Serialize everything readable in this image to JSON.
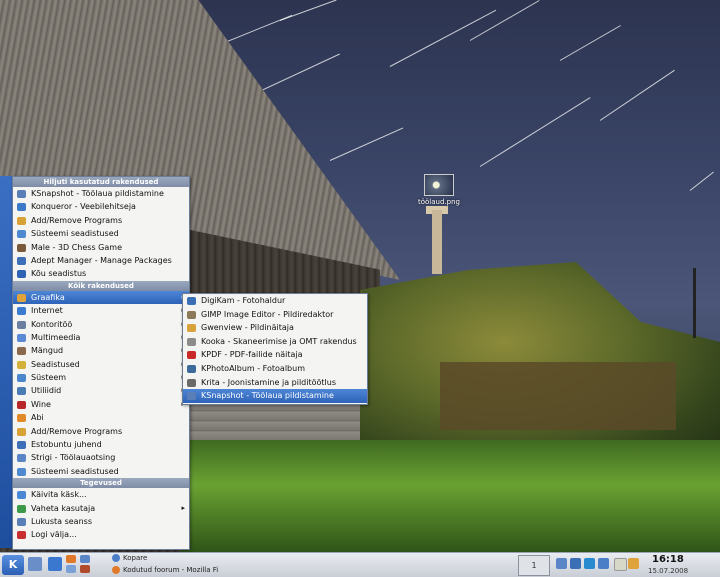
{
  "desktop": {
    "icon_label": "töölaud.png"
  },
  "kmenu": {
    "recent_header": "Hiljuti kasutatud rakendused",
    "recent": [
      {
        "label": "KSnapshot - Töölaua pildistamine",
        "icon": "camera-icon",
        "color": "#5a7fb8"
      },
      {
        "label": "Konqueror - Veebilehitseja",
        "icon": "globe-icon",
        "color": "#3c79c8"
      },
      {
        "label": "Add/Remove Programs",
        "icon": "package-icon",
        "color": "#d8a236"
      },
      {
        "label": "Süsteemi seadistused",
        "icon": "settings-icon",
        "color": "#4f8ad0"
      },
      {
        "label": "Male - 3D Chess Game",
        "icon": "chess-icon",
        "color": "#7b5a3c"
      },
      {
        "label": "Adept Manager - Manage Packages",
        "icon": "adept-icon",
        "color": "#3d6fb6"
      },
      {
        "label": "Kõu seadistus",
        "icon": "kde-icon",
        "color": "#2f63b4"
      }
    ],
    "all_header": "Kõik rakendused",
    "all": [
      {
        "label": "Graafika",
        "icon": "graphics-icon",
        "color": "#e0a23a",
        "submenu": true,
        "highlighted": true
      },
      {
        "label": "Internet",
        "icon": "internet-icon",
        "color": "#3a7bd0",
        "submenu": true
      },
      {
        "label": "Kontoritöö",
        "icon": "office-icon",
        "color": "#6d7fa0",
        "submenu": true
      },
      {
        "label": "Multimeedia",
        "icon": "multimedia-icon",
        "color": "#5a8ad6",
        "submenu": true
      },
      {
        "label": "Mängud",
        "icon": "games-icon",
        "color": "#8a6a4c",
        "submenu": true
      },
      {
        "label": "Seadistused",
        "icon": "settings-icon",
        "color": "#d4b23a",
        "submenu": true
      },
      {
        "label": "Süsteem",
        "icon": "system-icon",
        "color": "#4a86cc",
        "submenu": true
      },
      {
        "label": "Utiliidid",
        "icon": "utilities-icon",
        "color": "#4a7bb4",
        "submenu": true
      },
      {
        "label": "Wine",
        "icon": "wine-icon",
        "color": "#b8262a",
        "submenu": true
      },
      {
        "label": "Abi",
        "icon": "help-icon",
        "color": "#e08a2a"
      },
      {
        "label": "Add/Remove Programs",
        "icon": "package-icon",
        "color": "#d8a236"
      },
      {
        "label": "Estobuntu juhend",
        "icon": "guide-icon",
        "color": "#3c6fb6"
      },
      {
        "label": "Strigi - Töölauaotsing",
        "icon": "search-icon",
        "color": "#5a86c8"
      },
      {
        "label": "Süsteemi seadistused",
        "icon": "settings-icon",
        "color": "#4f8ad0"
      }
    ],
    "actions_header": "Tegevused",
    "actions": [
      {
        "label": "Käivita käsk...",
        "icon": "run-icon",
        "color": "#4a88d6"
      },
      {
        "label": "Vaheta kasutaja",
        "icon": "switch-user-icon",
        "color": "#3c9a48",
        "submenu": true
      },
      {
        "label": "Lukusta seanss",
        "icon": "lock-icon",
        "color": "#5a7fb8"
      },
      {
        "label": "Logi välja...",
        "icon": "logout-icon",
        "color": "#c83030"
      }
    ]
  },
  "submenu": {
    "items": [
      {
        "label": "DigiKam - Fotohaldur",
        "icon": "digikam-icon",
        "color": "#3a6fb6"
      },
      {
        "label": "GIMP Image Editor - Pildiredaktor",
        "icon": "gimp-icon",
        "color": "#8a7a5a"
      },
      {
        "label": "Gwenview - Pildinäitaja",
        "icon": "gwenview-icon",
        "color": "#d8a23a"
      },
      {
        "label": "Kooka - Skaneerimise ja OMT rakendus",
        "icon": "scanner-icon",
        "color": "#8c8c8c"
      },
      {
        "label": "KPDF - PDF-failide näitaja",
        "icon": "pdf-icon",
        "color": "#c82828"
      },
      {
        "label": "KPhotoAlbum - Fotoalbum",
        "icon": "photoalbum-icon",
        "color": "#3c6a9a"
      },
      {
        "label": "Krita - Joonistamine ja pilditöötlus",
        "icon": "krita-icon",
        "color": "#6a6a6a"
      },
      {
        "label": "KSnapshot - Töölaua pildistamine",
        "icon": "camera-icon",
        "color": "#5a7fb8",
        "highlighted": true
      }
    ]
  },
  "taskbar": {
    "tasks": [
      "Kopare",
      "Kodutud foorum - Mozilla Fi"
    ],
    "pager": "1",
    "time": "16:18",
    "date": "15.07.2008"
  }
}
